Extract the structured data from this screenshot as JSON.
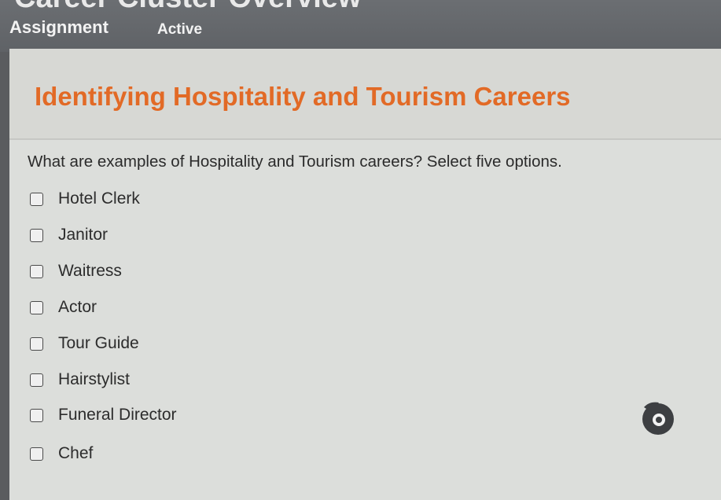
{
  "topbar": {
    "cut_title": "Career Cluster Overview",
    "assignment_label": "Assignment",
    "status": "Active"
  },
  "main": {
    "title": "Identifying Hospitality and Tourism Careers",
    "question": "What are examples of Hospitality and Tourism careers? Select five options.",
    "options": [
      {
        "label": "Hotel Clerk",
        "checked": false
      },
      {
        "label": "Janitor",
        "checked": false
      },
      {
        "label": "Waitress",
        "checked": false
      },
      {
        "label": "Actor",
        "checked": false
      },
      {
        "label": "Tour Guide",
        "checked": false
      },
      {
        "label": "Hairstylist",
        "checked": false
      },
      {
        "label": "Funeral Director",
        "checked": false
      },
      {
        "label": "Chef",
        "checked": false
      }
    ]
  },
  "colors": {
    "title_orange": "#e26a26",
    "panel_background": "#dcdedb",
    "topbar_background": "#63666a"
  },
  "icons": {
    "checkbox": "empty-checkbox-icon",
    "floating_bubble": "reader-bubble-icon"
  }
}
